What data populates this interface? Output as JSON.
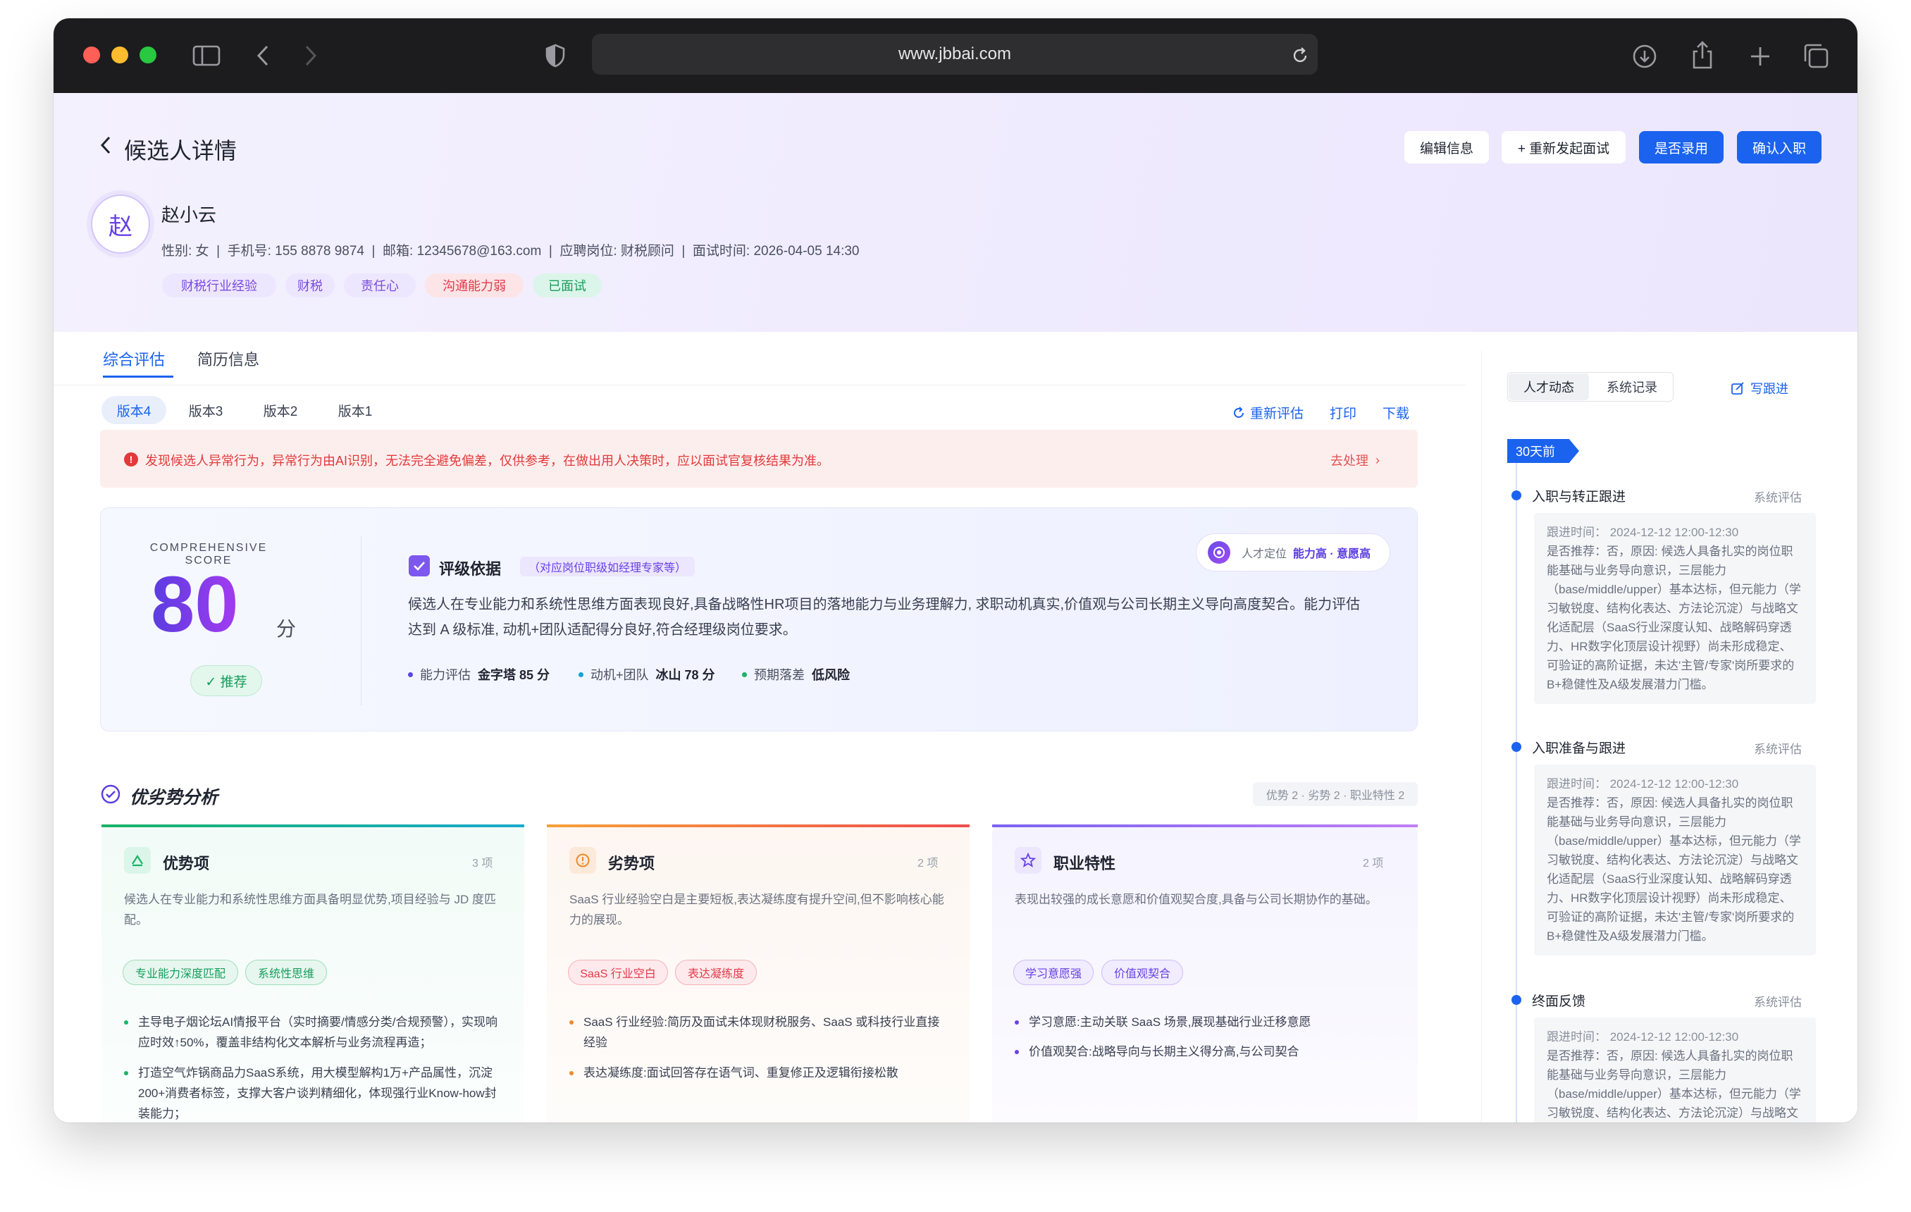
{
  "browser": {
    "url": "www.jbbai.com"
  },
  "page": {
    "back_title": "候选人详情"
  },
  "actions": {
    "edit": "编辑信息",
    "reinterview": "+ 重新发起面试",
    "hire": "是否录用",
    "onboard": "确认入职"
  },
  "candidate": {
    "avatar": "赵",
    "name": "赵小云",
    "info": "性别: 女  |  手机号: 155 8878 9874  |  邮箱: 12345678@163.com  |  应聘岗位: 财税顾问  |  面试时间: 2026-04-05 14:30",
    "tags": [
      "财税行业经验",
      "财税",
      "责任心",
      "沟通能力弱",
      "已面试"
    ]
  },
  "tabs": [
    "综合评估",
    "简历信息"
  ],
  "versions": [
    "版本4",
    "版本3",
    "版本2",
    "版本1"
  ],
  "tools": {
    "reeval": "重新评估",
    "print": "打印",
    "download": "下载"
  },
  "alert": {
    "text": "发现候选人异常行为，异常行为由AI识别，无法完全避免偏差，仅供参考，在做出用人决策时，应以面试官复核结果为准。",
    "action": "去处理"
  },
  "score": {
    "label": "COMPREHENSIVE SCORE",
    "value": "80",
    "unit": "分",
    "badge": "✓ 推荐",
    "basis_title": "评级依据",
    "basis_tag": "（对应岗位职级如经理专家等）",
    "position_label": "人才定位",
    "position_value": "能力高 · 意愿高",
    "text": "候选人在专业能力和系统性思维方面表现良好,具备战略性HR项目的落地能力与业务理解力, 求职动机真实,价值观与公司长期主义导向高度契合。能力评估达到 A 级标准, 动机+团队适配得分良好,符合经理级岗位要求。",
    "metrics": [
      {
        "label": "能力评估",
        "value": "金字塔 85 分",
        "color": "#5b45e0"
      },
      {
        "label": "动机+团队",
        "value": "冰山 78 分",
        "color": "#16a3d4"
      },
      {
        "label": "预期落差",
        "value": "低风险",
        "color": "#19b466"
      }
    ]
  },
  "analysis": {
    "title": "优劣势分析",
    "summary": "优势 2 · 劣势 2 · 职业特性 2",
    "cards": [
      {
        "title": "优势项",
        "count": "3 项",
        "desc": "候选人在专业能力和系统性思维方面具备明显优势,项目经验与 JD 度匹配。",
        "chips": [
          "专业能力深度匹配",
          "系统性思维"
        ],
        "items": [
          "主导电子烟论坛AI情报平台（实时摘要/情感分类/合规预警），实现响应时效↑50%，覆盖非结构化文本解析与业务流程再造；",
          "打造空气炸锅商品力SaaS系统，用大模型解构1万+产品属性，沉淀200+消费者标签，支撑大客户谈判精细化，体现强行业Know-how封装能力；"
        ]
      },
      {
        "title": "劣势项",
        "count": "2 项",
        "desc": "SaaS 行业经验空白是主要短板,表达凝练度有提升空间,但不影响核心能力的展现。",
        "chips": [
          "SaaS 行业空白",
          "表达凝练度"
        ],
        "items": [
          "SaaS 行业经验:简历及面试未体现财税服务、SaaS 或科技行业直接经验",
          "表达凝练度:面试回答存在语气词、重复修正及逻辑衔接松散"
        ]
      },
      {
        "title": "职业特性",
        "count": "2 项",
        "desc": "表现出较强的成长意愿和价值观契合度,具备与公司长期协作的基础。",
        "chips": [
          "学习意愿强",
          "价值观契合"
        ],
        "items": [
          "学习意愿:主动关联 SaaS 场景,展现基础行业迁移意愿",
          "价值观契合:战略导向与长期主义得分高,与公司契合"
        ]
      }
    ]
  },
  "side": {
    "tabs": [
      "人才动态",
      "系统记录"
    ],
    "write": "写跟进",
    "period": "30天前",
    "events": [
      {
        "title": "入职与转正跟进",
        "source": "系统评估",
        "time": "跟进时间：  2024-12-12 12:00-12:30",
        "body": "是否推荐：否，原因: 候选人具备扎实的岗位职能基础与业务导向意识，三层能力（base/middle/upper）基本达标，但元能力（学习敏锐度、结构化表达、方法论沉淀）与战略文化适配层（SaaS行业深度认知、战略解码穿透力、HR数字化顶层设计视野）尚未形成稳定、可验证的高阶证据，未达'主管/专家'岗所要求的B+稳健性及A级发展潜力门槛。"
      },
      {
        "title": "入职准备与跟进",
        "source": "系统评估",
        "time": "跟进时间：  2024-12-12 12:00-12:30",
        "body": "是否推荐：否，原因: 候选人具备扎实的岗位职能基础与业务导向意识，三层能力（base/middle/upper）基本达标，但元能力（学习敏锐度、结构化表达、方法论沉淀）与战略文化适配层（SaaS行业深度认知、战略解码穿透力、HR数字化顶层设计视野）尚未形成稳定、可验证的高阶证据，未达'主管/专家'岗所要求的B+稳健性及A级发展潜力门槛。"
      },
      {
        "title": "终面反馈",
        "source": "系统评估",
        "time": "跟进时间：  2024-12-12 12:00-12:30",
        "body": "是否推荐：否，原因: 候选人具备扎实的岗位职能基础与业务导向意识，三层能力（base/middle/upper）基本达标，但元能力（学习敏锐度、结构化表达、方法论沉淀）与战略文化适配层（SaaS行业深度认知、战略解码穿透力、HR数字化顶层设计视野）尚未形成稳定、可验证的高阶证据，未达'主管/专家'岗所要求的B+稳健性及A级发展潜力门槛。"
      }
    ]
  }
}
